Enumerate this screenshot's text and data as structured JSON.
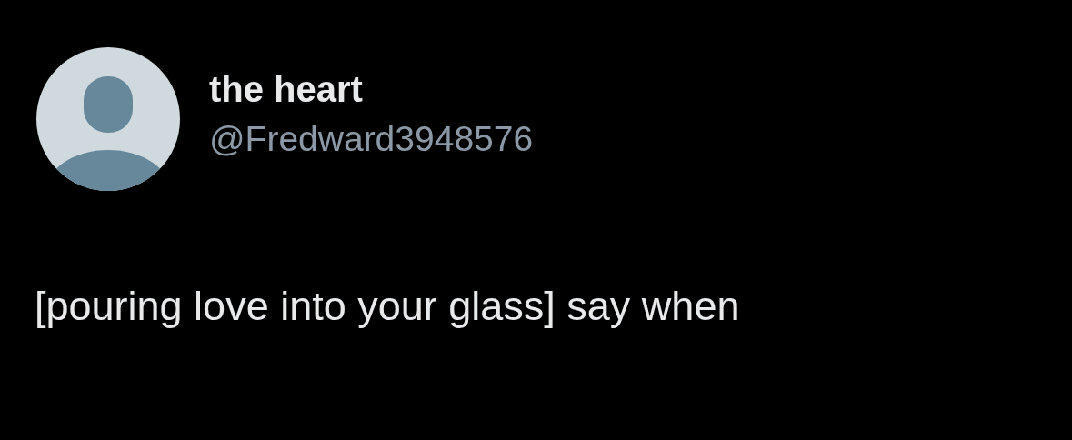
{
  "author": {
    "name": "the heart",
    "handle": "@Fredward3948576"
  },
  "tweet": {
    "text": "[pouring love into your glass] say when"
  }
}
